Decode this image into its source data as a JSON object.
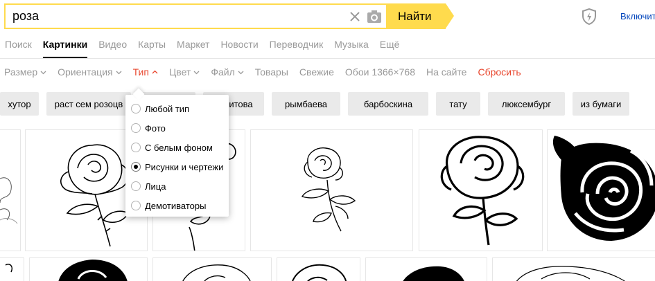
{
  "search": {
    "query": "роза",
    "submit_label": "Найти"
  },
  "header": {
    "enable_label": "Включить"
  },
  "tabs": [
    {
      "label": "Поиск"
    },
    {
      "label": "Картинки"
    },
    {
      "label": "Видео"
    },
    {
      "label": "Карты"
    },
    {
      "label": "Маркет"
    },
    {
      "label": "Новости"
    },
    {
      "label": "Переводчик"
    },
    {
      "label": "Музыка"
    },
    {
      "label": "Ещё"
    }
  ],
  "filters": {
    "size": "Размер",
    "orientation": "Ориентация",
    "type": "Тип",
    "color": "Цвет",
    "file": "Файл",
    "goods": "Товары",
    "fresh": "Свежие",
    "wallpaper": "Обои 1366×768",
    "on_site": "На сайте",
    "reset": "Сбросить"
  },
  "chips": [
    "хутор",
    "раст сем розоцв",
    "",
    "сябитова",
    "рымбаева",
    "барбоскина",
    "тату",
    "люксембург",
    "из бумаги"
  ],
  "type_menu": {
    "options": [
      {
        "label": "Любой тип",
        "checked": false
      },
      {
        "label": "Фото",
        "checked": false
      },
      {
        "label": "С белым фоном",
        "checked": false
      },
      {
        "label": "Рисунки и чертежи",
        "checked": true
      },
      {
        "label": "Лица",
        "checked": false
      },
      {
        "label": "Демотиваторы",
        "checked": false
      }
    ]
  },
  "colors": {
    "accent": "#ffdb4d",
    "active_filter": "#e8452c",
    "link": "#0044bb",
    "muted": "#999999"
  }
}
